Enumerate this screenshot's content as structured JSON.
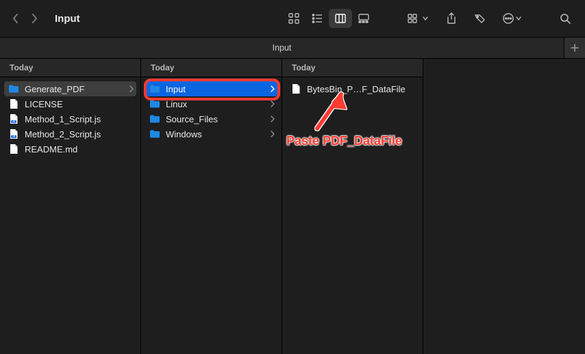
{
  "window": {
    "title": "Input",
    "tab_label": "Input"
  },
  "columns": [
    {
      "header": "Today",
      "items": [
        {
          "icon": "folder",
          "label": "Generate_PDF",
          "chevron": true,
          "sel": "dim"
        },
        {
          "icon": "doc",
          "label": "LICENSE"
        },
        {
          "icon": "js",
          "label": "Method_1_Script.js"
        },
        {
          "icon": "js",
          "label": "Method_2_Script.js"
        },
        {
          "icon": "doc",
          "label": "README.md"
        }
      ]
    },
    {
      "header": "Today",
      "highlight": true,
      "items": [
        {
          "icon": "folder",
          "label": "Input",
          "chevron": true,
          "sel": "blue"
        },
        {
          "icon": "folder",
          "label": "Linux",
          "chevron": true
        },
        {
          "icon": "folder",
          "label": "Source_Files",
          "chevron": true
        },
        {
          "icon": "folder",
          "label": "Windows",
          "chevron": true
        }
      ]
    },
    {
      "header": "Today",
      "items": [
        {
          "icon": "doc",
          "label": "BytesBin_P…F_DataFile"
        }
      ]
    }
  ],
  "annotation": {
    "text": "Paste PDF_DataFile"
  },
  "colors": {
    "highlight": "#ff3b30",
    "selection": "#0a66e0",
    "folder": "#1e88e5"
  }
}
